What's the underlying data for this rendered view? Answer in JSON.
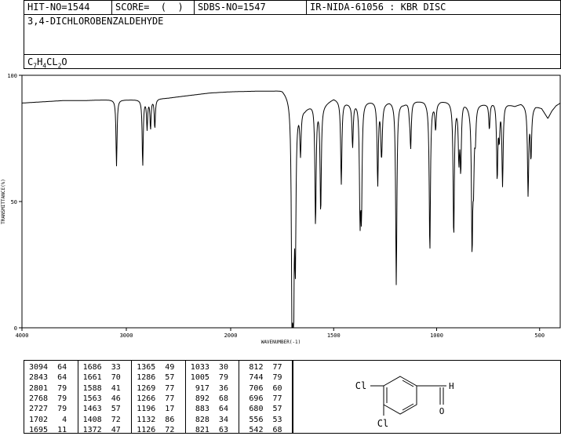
{
  "header": {
    "hit_no": "HIT-NO=1544",
    "score": "SCORE=  (  )",
    "sdbs_no": "SDBS-NO=1547",
    "ir_no": "IR-NIDA-61056 : KBR DISC",
    "compound": "3,4-DICHLOROBENZALDEHYDE",
    "formula": {
      "c": "C",
      "c_n": "7",
      "h": "H",
      "h_n": "4",
      "cl": "CL",
      "cl_n": "2",
      "o": "O"
    }
  },
  "chart_data": {
    "type": "line",
    "title": "",
    "xlabel": "WAVENUMBER(-1)",
    "ylabel": "TRANSMITTANCE(%)",
    "xlim": [
      4000,
      400
    ],
    "ylim": [
      0,
      100
    ],
    "x_ticks": [
      "4000",
      "3000",
      "2000",
      "1500",
      "1000",
      "500"
    ],
    "y_ticks": [
      "100",
      "50",
      "0"
    ],
    "grid": false,
    "baseline": [
      [
        4000,
        89
      ],
      [
        3800,
        89.5
      ],
      [
        3600,
        90
      ],
      [
        3400,
        90
      ],
      [
        3200,
        90.3
      ],
      [
        3000,
        90.3
      ],
      [
        2800,
        90.5
      ],
      [
        2600,
        91
      ],
      [
        2400,
        92
      ],
      [
        2200,
        93
      ],
      [
        2000,
        93.5
      ],
      [
        1800,
        94
      ],
      [
        1750,
        94.5
      ],
      [
        1710,
        92
      ],
      [
        1690,
        88
      ],
      [
        1640,
        87
      ],
      [
        1600,
        89
      ],
      [
        1560,
        88
      ],
      [
        1500,
        91
      ],
      [
        1460,
        90
      ],
      [
        1420,
        89
      ],
      [
        1380,
        90
      ],
      [
        1340,
        90
      ],
      [
        1300,
        90
      ],
      [
        1260,
        89
      ],
      [
        1230,
        90
      ],
      [
        1200,
        90
      ],
      [
        1160,
        89
      ],
      [
        1130,
        90
      ],
      [
        1100,
        90
      ],
      [
        1060,
        90
      ],
      [
        1040,
        89
      ],
      [
        1010,
        89
      ],
      [
        980,
        90
      ],
      [
        940,
        90
      ],
      [
        900,
        89
      ],
      [
        870,
        90
      ],
      [
        840,
        88
      ],
      [
        800,
        89
      ],
      [
        760,
        89
      ],
      [
        720,
        90
      ],
      [
        690,
        90
      ],
      [
        660,
        89
      ],
      [
        620,
        88
      ],
      [
        590,
        89
      ],
      [
        560,
        88
      ],
      [
        540,
        87
      ],
      [
        520,
        88
      ],
      [
        490,
        87
      ],
      [
        460,
        83
      ],
      [
        440,
        86
      ],
      [
        420,
        88
      ],
      [
        400,
        89
      ]
    ],
    "peaks": [
      {
        "x": 3094,
        "y": 64
      },
      {
        "x": 2843,
        "y": 64
      },
      {
        "x": 2801,
        "y": 79
      },
      {
        "x": 2768,
        "y": 79
      },
      {
        "x": 2727,
        "y": 79
      },
      {
        "x": 1702,
        "y": 4
      },
      {
        "x": 1695,
        "y": 11
      },
      {
        "x": 1686,
        "y": 33
      },
      {
        "x": 1661,
        "y": 70
      },
      {
        "x": 1588,
        "y": 41
      },
      {
        "x": 1563,
        "y": 46
      },
      {
        "x": 1463,
        "y": 57
      },
      {
        "x": 1408,
        "y": 72
      },
      {
        "x": 1372,
        "y": 47
      },
      {
        "x": 1365,
        "y": 49
      },
      {
        "x": 1286,
        "y": 57
      },
      {
        "x": 1269,
        "y": 77
      },
      {
        "x": 1266,
        "y": 77
      },
      {
        "x": 1196,
        "y": 17
      },
      {
        "x": 1132,
        "y": 86
      },
      {
        "x": 1126,
        "y": 72
      },
      {
        "x": 1033,
        "y": 30
      },
      {
        "x": 1005,
        "y": 79
      },
      {
        "x": 917,
        "y": 36
      },
      {
        "x": 892,
        "y": 68
      },
      {
        "x": 883,
        "y": 64
      },
      {
        "x": 828,
        "y": 34
      },
      {
        "x": 821,
        "y": 63
      },
      {
        "x": 812,
        "y": 77
      },
      {
        "x": 744,
        "y": 79
      },
      {
        "x": 706,
        "y": 60
      },
      {
        "x": 696,
        "y": 77
      },
      {
        "x": 680,
        "y": 57
      },
      {
        "x": 556,
        "y": 53
      },
      {
        "x": 542,
        "y": 68
      }
    ]
  },
  "peak_table": {
    "columns": [
      [
        "3094  64",
        "2843  64",
        "2801  79",
        "2768  79",
        "2727  79",
        "1702   4",
        "1695  11"
      ],
      [
        "1686  33",
        "1661  70",
        "1588  41",
        "1563  46",
        "1463  57",
        "1408  72",
        "1372  47"
      ],
      [
        "1365  49",
        "1286  57",
        "1269  77",
        "1266  77",
        "1196  17",
        "1132  86",
        "1126  72"
      ],
      [
        "1033  30",
        "1005  79",
        " 917  36",
        " 892  68",
        " 883  64",
        " 828  34",
        " 821  63"
      ],
      [
        " 812  77",
        " 744  79",
        " 706  60",
        " 696  77",
        " 680  57",
        " 556  53",
        " 542  68"
      ]
    ]
  },
  "structure": {
    "cl_top": "Cl",
    "cl_bottom": "Cl",
    "h": "H",
    "o": "O"
  }
}
